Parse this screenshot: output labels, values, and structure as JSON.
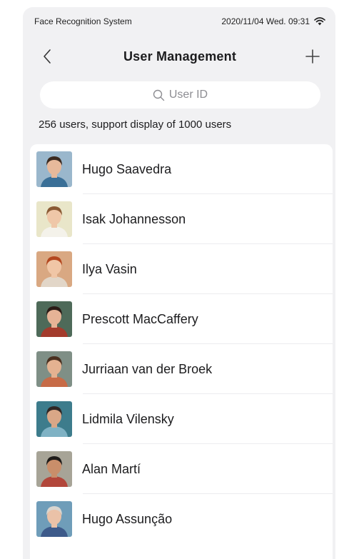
{
  "status_bar": {
    "app_name": "Face Recognition System",
    "datetime": "2020/11/04  Wed.  09:31",
    "wifi_icon": "wifi-icon"
  },
  "header": {
    "title": "User Management",
    "back_icon": "chevron-left-icon",
    "add_icon": "plus-icon"
  },
  "search": {
    "placeholder": "User ID",
    "icon": "search-icon"
  },
  "summary": {
    "text": "256 users,  support display of 1000 users"
  },
  "users": [
    {
      "name": "Hugo Saavedra",
      "bg": "#9ab7cc",
      "skin": "#e7b99b",
      "hair": "#3b2a20",
      "shirt": "#3a6f97"
    },
    {
      "name": "Isak Johannesson",
      "bg": "#e9e6c9",
      "skin": "#efc7a8",
      "hair": "#8a5a34",
      "shirt": "#f4f2ea"
    },
    {
      "name": "Ilya Vasin",
      "bg": "#d9a882",
      "skin": "#f0c6a6",
      "hair": "#b4471f",
      "shirt": "#e2d6c8"
    },
    {
      "name": "Prescott MacCaffery",
      "bg": "#4e6a59",
      "skin": "#e6b396",
      "hair": "#2a1b16",
      "shirt": "#a33b2c"
    },
    {
      "name": "Jurriaan van der Broek",
      "bg": "#7f8f86",
      "skin": "#e4b291",
      "hair": "#4a3020",
      "shirt": "#c76b47"
    },
    {
      "name": "Lidmila Vilensky",
      "bg": "#3d7c8c",
      "skin": "#d9a787",
      "hair": "#2f2624",
      "shirt": "#7fb2c4"
    },
    {
      "name": "Alan Martí",
      "bg": "#a7a497",
      "skin": "#c98e6a",
      "hair": "#1e1b19",
      "shirt": "#b2463a"
    },
    {
      "name": "Hugo Assunção",
      "bg": "#6f9db9",
      "skin": "#eac2a8",
      "hair": "#d9d5cf",
      "shirt": "#3d5a8a"
    }
  ]
}
